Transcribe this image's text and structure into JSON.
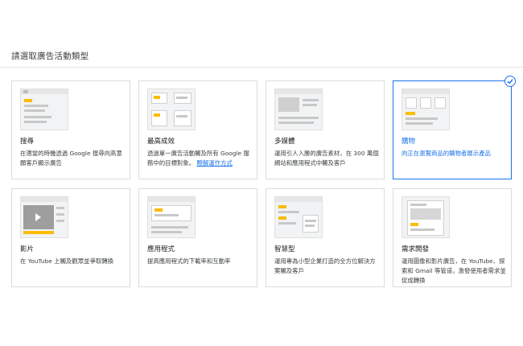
{
  "page": {
    "heading": "請選取廣告活動類型"
  },
  "cards": [
    {
      "title": "搜尋",
      "desc": "在適當的時機透過 Google 搜尋向高意願客戶顯示廣告",
      "link": "",
      "selected": false,
      "icon": "search-ad-thumbnail"
    },
    {
      "title": "最高成效",
      "desc": "透過單一廣告活動觸及所有 Google 服務中的目標對象。",
      "link": "瞭解運作方式",
      "selected": false,
      "icon": "performance-max-thumbnail"
    },
    {
      "title": "多媒體",
      "desc": "運用引人入勝的廣告素材，在 300 萬個網站和應用程式中觸及客戶",
      "link": "",
      "selected": false,
      "icon": "display-ad-thumbnail"
    },
    {
      "title": "購物",
      "desc": "向正在瀏覽商品的購物者展示產品",
      "link": "",
      "selected": true,
      "icon": "shopping-ad-thumbnail"
    },
    {
      "title": "影片",
      "desc": "在 YouTube 上觸及觀眾並爭取轉換",
      "link": "",
      "selected": false,
      "icon": "video-ad-thumbnail"
    },
    {
      "title": "應用程式",
      "desc": "提高應用程式的下載率和互動率",
      "link": "",
      "selected": false,
      "icon": "app-ad-thumbnail"
    },
    {
      "title": "智慧型",
      "desc": "運用專為小型企業打造的全方位解決方案觸及客戶",
      "link": "",
      "selected": false,
      "icon": "smart-ad-thumbnail"
    },
    {
      "title": "需求開發",
      "desc": "運用圖像和影片廣告，在 YouTube、探索和 Gmail 等管道，激發使用者需求並促成轉換",
      "link": "",
      "selected": false,
      "icon": "demand-gen-thumbnail"
    }
  ],
  "colors": {
    "accent": "#1a73e8",
    "highlight": "#fbbc04",
    "border": "#dadce0"
  }
}
